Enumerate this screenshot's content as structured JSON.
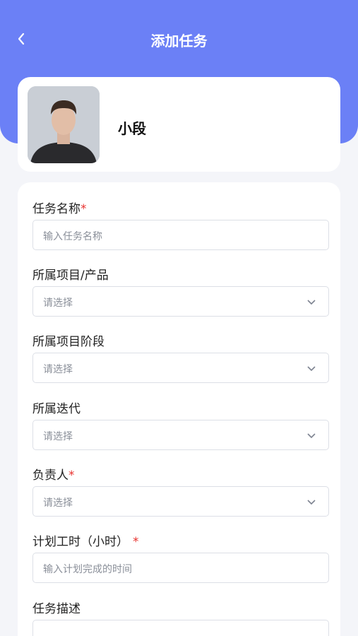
{
  "header": {
    "title": "添加任务",
    "back_icon": "chevron-left-icon"
  },
  "user": {
    "name": "小段"
  },
  "form": {
    "task_name": {
      "label": "任务名称",
      "required": "*",
      "placeholder": "输入任务名称"
    },
    "project": {
      "label": "所属项目/产品",
      "placeholder": "请选择"
    },
    "stage": {
      "label": "所属项目阶段",
      "placeholder": "请选择"
    },
    "iteration": {
      "label": "所属迭代",
      "placeholder": "请选择"
    },
    "owner": {
      "label": "负责人",
      "required": "*",
      "placeholder": "请选择"
    },
    "hours": {
      "label": "计划工时（小时）",
      "required": "*",
      "placeholder": "输入计划完成的时间"
    },
    "description": {
      "label": "任务描述"
    }
  },
  "colors": {
    "primary": "#6b80f6",
    "required": "#e8322f"
  }
}
